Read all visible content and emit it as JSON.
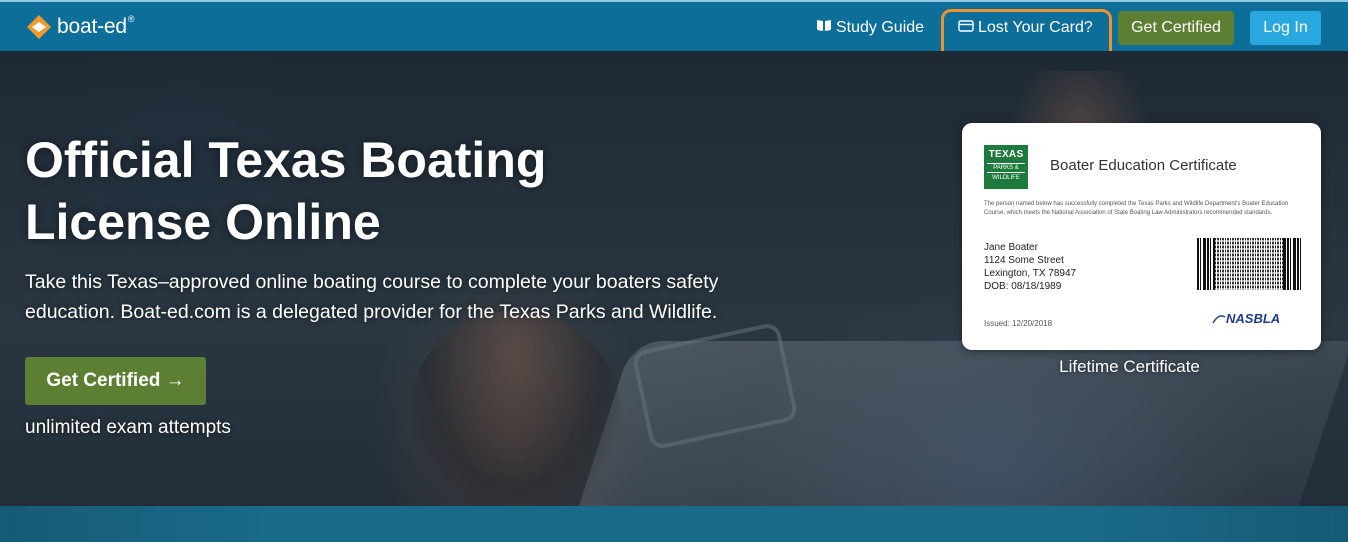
{
  "nav": {
    "logo_text": "boat-ed",
    "logo_reg": "®",
    "study_guide": "Study Guide",
    "lost_card": "Lost Your Card?",
    "get_certified": "Get Certified",
    "log_in": "Log In",
    "highlight_color": "#f0932b"
  },
  "hero": {
    "title": "Official Texas Boating License Online",
    "subtitle": "Take this Texas–approved online boating course to complete your boaters safety education. Boat-ed.com is a delegated provider for the Texas Parks and Wildlife.",
    "cta": "Get Certified →",
    "cta_note": "unlimited exam attempts"
  },
  "certificate": {
    "badge_line1": "TEXAS",
    "badge_line2": "PARKS &",
    "badge_line3": "WILDLIFE",
    "title": "Boater Education Certificate",
    "body": "The person named below has successfully completed the Texas Parks and Wildlife Department's Boater Education Course, which meets the National Association of State Boating Law Administrators recommended standards.",
    "name": "Jane Boater",
    "street": "1124 Some Street",
    "city": "Lexington, TX 78947",
    "dob": "DOB: 08/18/1989",
    "issued": "Issued: 12/20/2018",
    "org": "NASBLA",
    "caption": "Lifetime Certificate"
  },
  "colors": {
    "nav_bg": "#0c6e99",
    "green_button": "#5d7f33",
    "login_button": "#29a8e0"
  }
}
